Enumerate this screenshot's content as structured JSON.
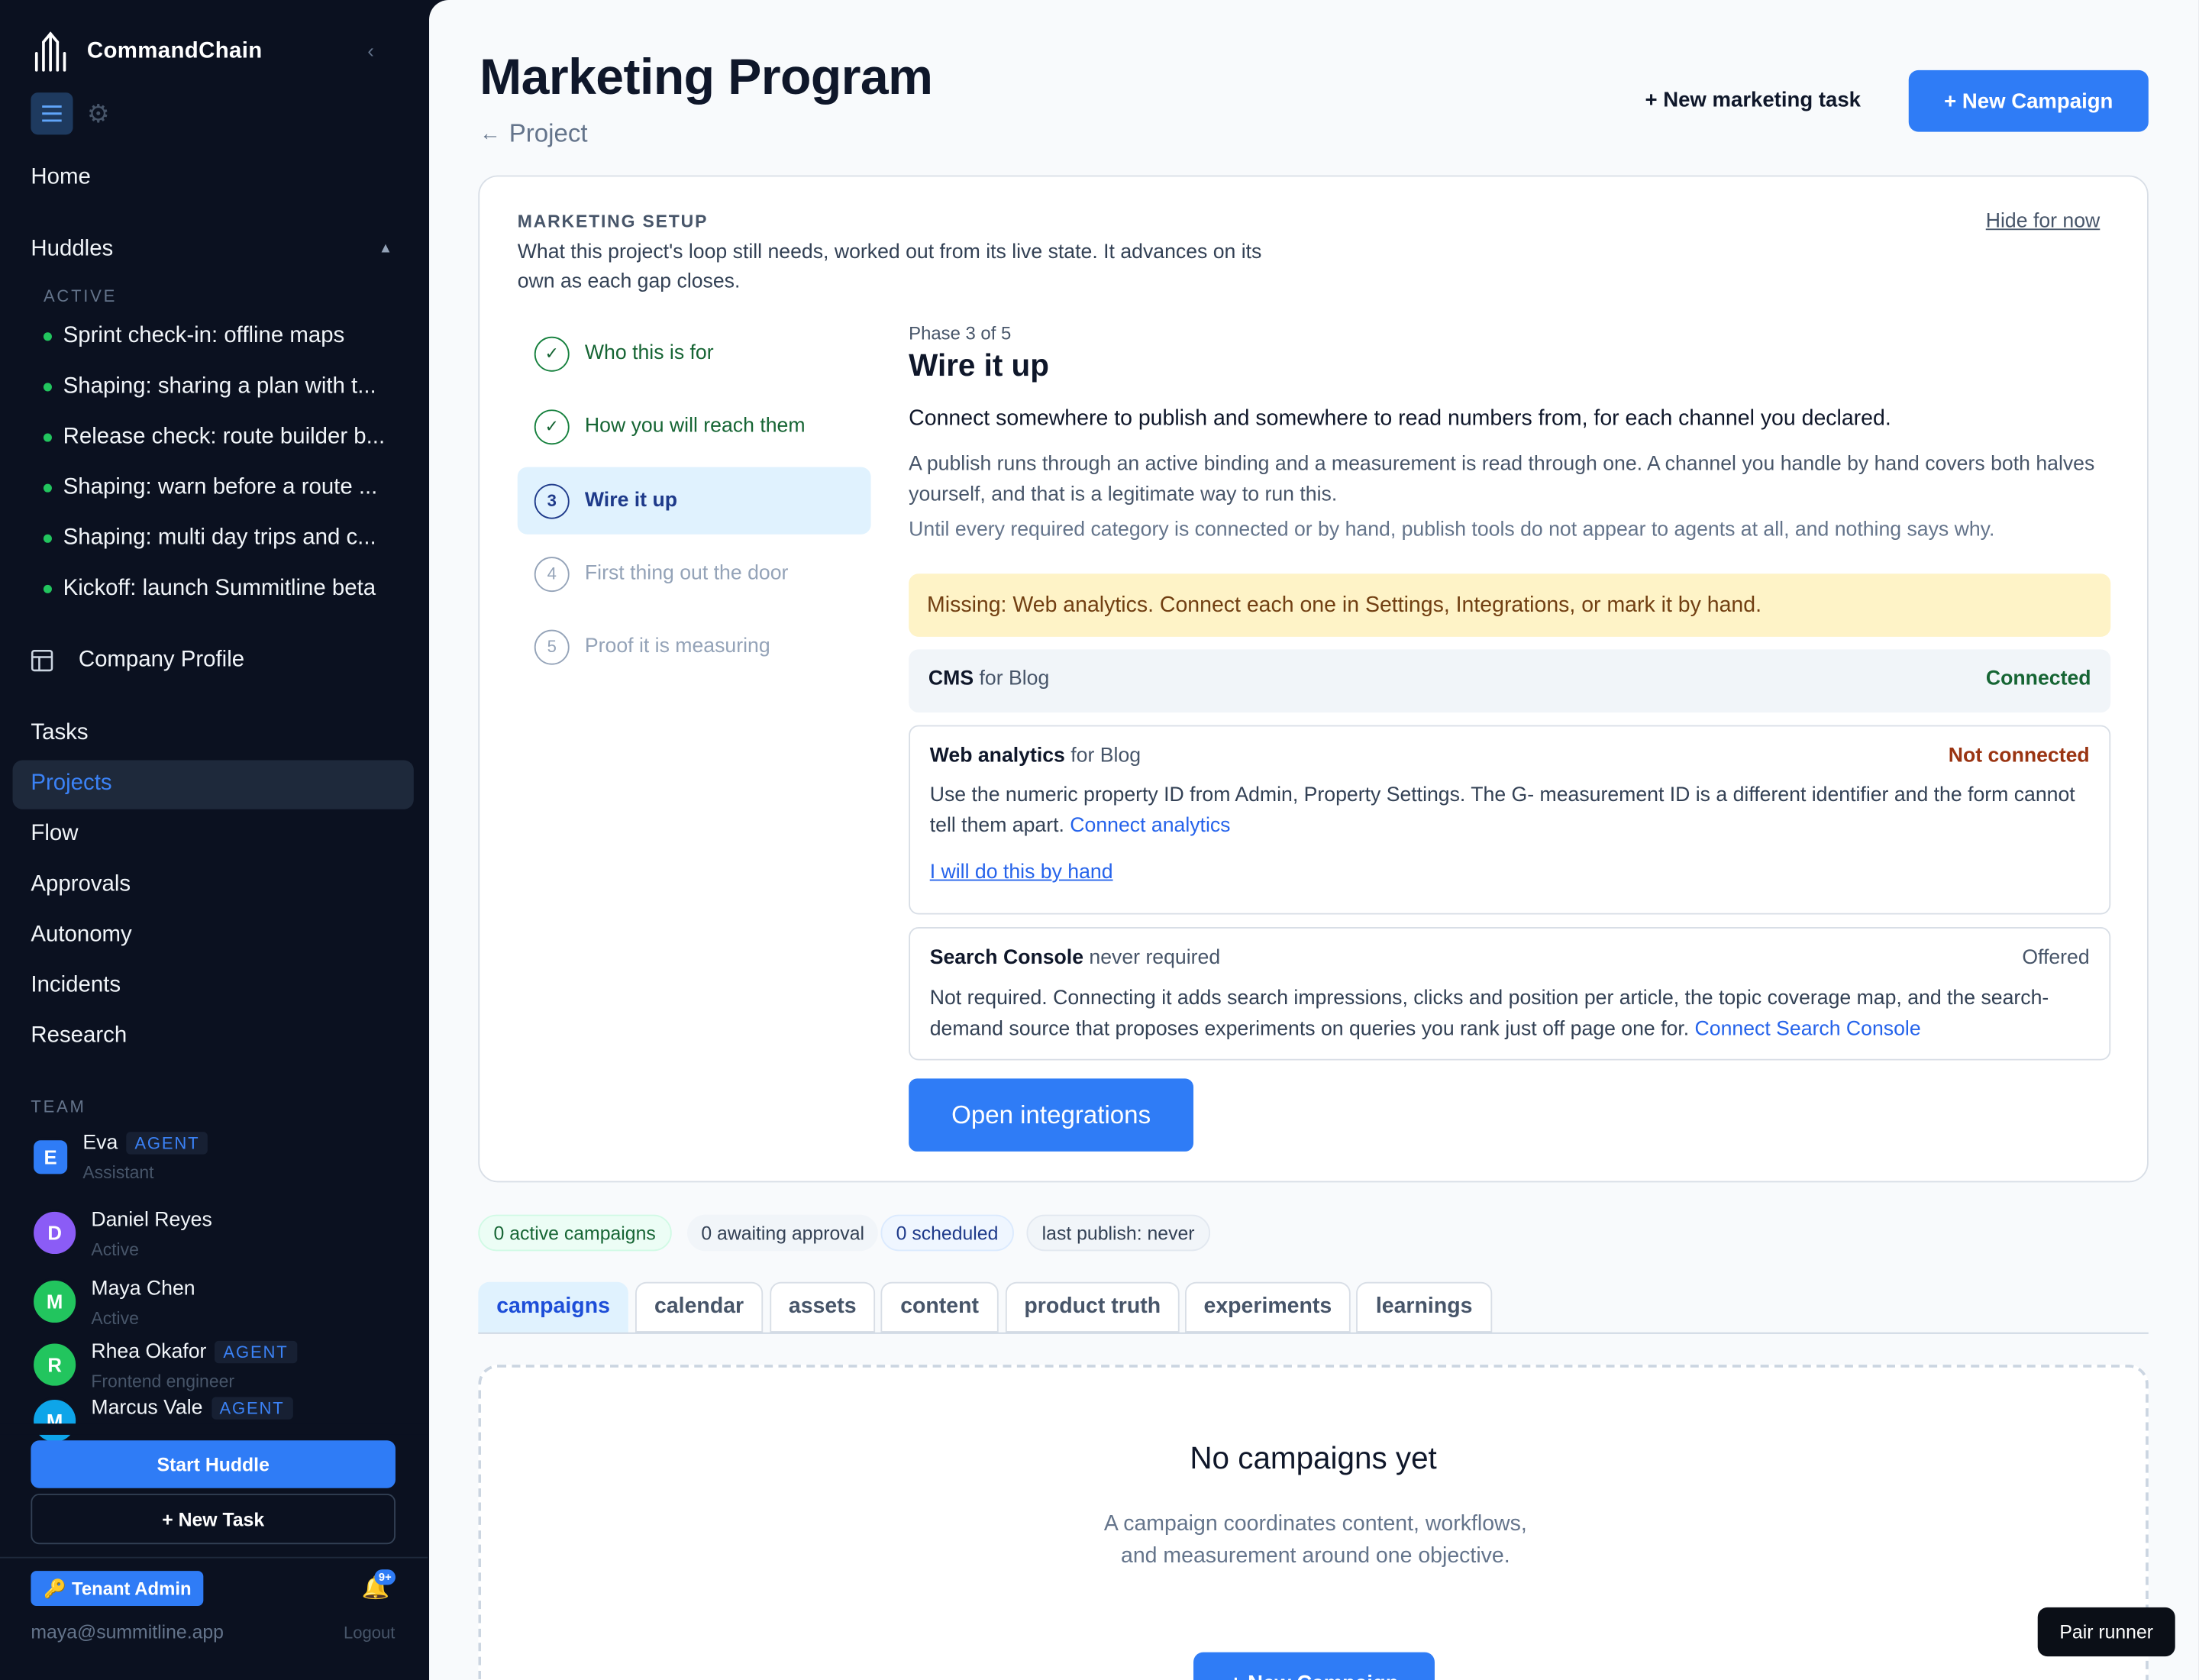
{
  "app": {
    "name": "CommandChain"
  },
  "sidebar": {
    "home": "Home",
    "huddles_heading": "Huddles",
    "active_label": "ACTIVE",
    "huddles": [
      "Sprint check-in: offline maps",
      "Shaping: sharing a plan with t...",
      "Release check: route builder b...",
      "Shaping: warn before a route ...",
      "Shaping: multi day trips and c...",
      "Kickoff: launch Summitline beta"
    ],
    "company_profile": "Company Profile",
    "nav": [
      "Tasks",
      "Projects",
      "Flow",
      "Approvals",
      "Autonomy",
      "Incidents",
      "Research"
    ],
    "active_nav": "Projects",
    "team_label": "TEAM",
    "team": [
      {
        "initial": "E",
        "name": "Eva",
        "badge": "AGENT",
        "role": "Assistant",
        "color": "#2f7cf6"
      },
      {
        "initial": "D",
        "name": "Daniel Reyes",
        "badge": "",
        "role": "Active",
        "color": "#8b5cf6"
      },
      {
        "initial": "M",
        "name": "Maya Chen",
        "badge": "",
        "role": "Active",
        "color": "#22c55e"
      },
      {
        "initial": "R",
        "name": "Rhea Okafor",
        "badge": "AGENT",
        "role": "Frontend engineer",
        "color": "#22c55e"
      },
      {
        "initial": "M",
        "name": "Marcus Vale",
        "badge": "AGENT",
        "role": "",
        "color": "#0ea5e9"
      }
    ],
    "start_huddle": "Start Huddle",
    "new_task": "+ New Task",
    "tenant_admin": "Tenant Admin",
    "notif_count": "9+",
    "email": "maya@summitline.app",
    "logout": "Logout"
  },
  "header": {
    "title": "Marketing Program",
    "breadcrumb_arrow": "←",
    "breadcrumb": "Project",
    "new_marketing_task": "+ New marketing task",
    "new_campaign": "+ New Campaign"
  },
  "setup": {
    "kicker": "MARKETING SETUP",
    "description": "What this project's loop still needs, worked out from its live state. It advances on its own as each gap closes.",
    "hide": "Hide for now",
    "steps": [
      {
        "mark": "✓",
        "label": "Who this is for",
        "state": "done"
      },
      {
        "mark": "✓",
        "label": "How you will reach them",
        "state": "done"
      },
      {
        "mark": "3",
        "label": "Wire it up",
        "state": "current"
      },
      {
        "mark": "4",
        "label": "First thing out the door",
        "state": "todo"
      },
      {
        "mark": "5",
        "label": "Proof it is measuring",
        "state": "todo"
      }
    ],
    "phase_label": "Phase 3 of 5",
    "phase_title": "Wire it up",
    "phase_lead": "Connect somewhere to publish and somewhere to read numbers from, for each channel you declared.",
    "phase_p1": "A publish runs through an active binding and a measurement is read through one. A channel you handle by hand covers both halves yourself, and that is a legitimate way to run this.",
    "phase_p2": "Until every required category is connected or by hand, publish tools do not appear to agents at all, and nothing says why.",
    "missing": "Missing: Web analytics. Connect each one in Settings, Integrations, or mark it by hand.",
    "integrations": {
      "cms": {
        "name": "CMS",
        "ctx": " for Blog",
        "status": "Connected"
      },
      "analytics": {
        "name": "Web analytics",
        "ctx": " for Blog",
        "status": "Not connected",
        "body": "Use the numeric property ID from Admin, Property Settings. The G- measurement ID is a different identifier and the form cannot tell them apart. ",
        "link": "Connect analytics",
        "by_hand": "I will do this by hand"
      },
      "search_console": {
        "name": "Search Console",
        "ctx": " never required",
        "status": "Offered",
        "body": "Not required. Connecting it adds search impressions, clicks and position per article, the topic coverage map, and the search-demand source that proposes experiments on queries you rank just off page one for. ",
        "link": "Connect Search Console"
      }
    },
    "open_integrations": "Open integrations"
  },
  "stats": {
    "active_campaigns": "0 active campaigns",
    "awaiting": "0 awaiting approval",
    "scheduled": "0 scheduled",
    "last_publish": "last publish: never"
  },
  "tabs": [
    "campaigns",
    "calendar",
    "assets",
    "content",
    "product truth",
    "experiments",
    "learnings"
  ],
  "active_tab": "campaigns",
  "empty": {
    "title": "No campaigns yet",
    "description": "A campaign coordinates content, workflows, and measurement around one objective.",
    "button": "+ New Campaign"
  },
  "pair_runner": "Pair runner",
  "colors": {
    "accent": "#2f7cf6",
    "connected": "#166534",
    "not_connected": "#9a3412",
    "sidebar_bg": "#0b1120"
  }
}
